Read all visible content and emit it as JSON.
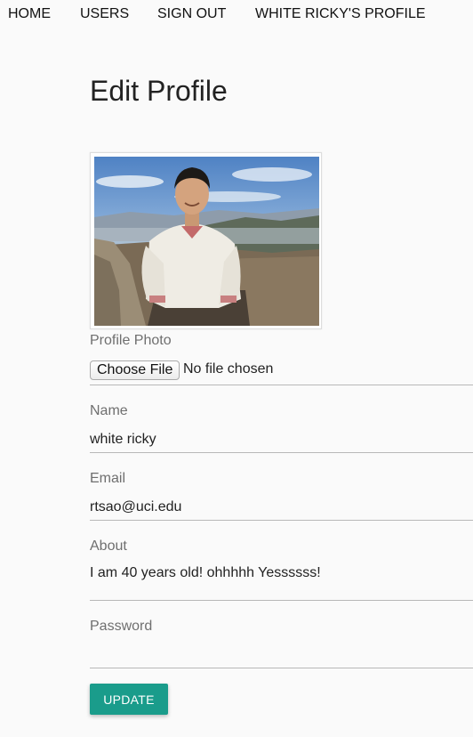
{
  "nav": {
    "items": [
      {
        "label": "HOME"
      },
      {
        "label": "USERS"
      },
      {
        "label": "SIGN OUT"
      },
      {
        "label": "WHITE RICKY'S PROFILE"
      }
    ]
  },
  "page": {
    "title": "Edit Profile"
  },
  "form": {
    "photo": {
      "label": "Profile Photo",
      "choose_button": "Choose File",
      "status": "No file chosen"
    },
    "name": {
      "label": "Name",
      "value": "white ricky"
    },
    "email": {
      "label": "Email",
      "value": "rtsao@uci.edu"
    },
    "about": {
      "label": "About",
      "value": "I am 40 years old! ohhhhh Yessssss!"
    },
    "password": {
      "label": "Password",
      "value": ""
    },
    "submit_label": "UPDATE"
  },
  "colors": {
    "accent": "#1a9c8b",
    "background": "#fafafa"
  }
}
